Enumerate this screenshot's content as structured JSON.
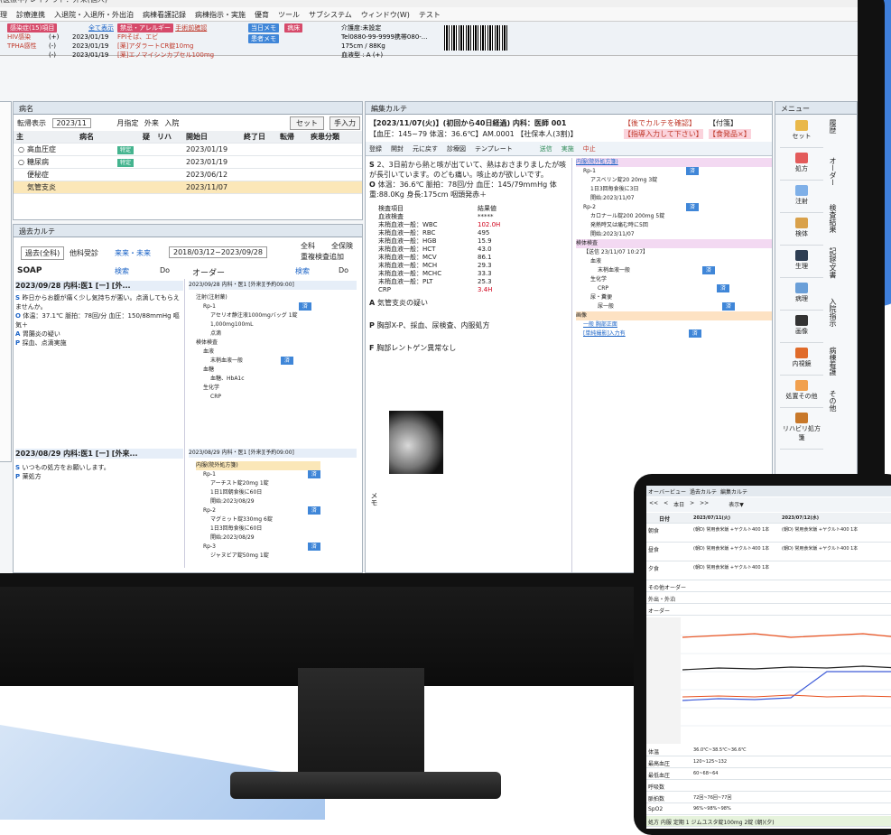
{
  "window": {
    "title": "環境(医療中) レイアウト：外来(個人)",
    "menu": [
      "者管理",
      "診療連携",
      "入退院・入退所・外出泊",
      "病棟看護記録",
      "病棟指示・実施",
      "優育",
      "ツール",
      "サブシステム",
      "ウィンドウ(W)",
      "テスト"
    ]
  },
  "patient_bar": {
    "alerts": [
      "感染症(15)項目",
      "HIV感染",
      "TPHA感性",
      "HBs抗原"
    ],
    "alert_vals": [
      "(+)",
      "(-)",
      "(-)"
    ],
    "alert_dates": [
      "2023/01/19",
      "2023/01/19",
      "2023/01/19"
    ],
    "all_label": "全て表示",
    "allergy_title": "禁忌・アレルギー",
    "allergy_sub": "手術前確認",
    "allergy_items": [
      "FPIそば、エビ",
      "[薬]アダラートCR錠10mg",
      "[薬]エノマイシンカプセル100mg"
    ],
    "memo_today": "当日メモ",
    "memo_patient": "患者メモ",
    "ward": "病床",
    "contact": [
      "介護度:未設定",
      "Tel0880-99-9999携帯080-...",
      "175cm / 88Kg",
      "血液型 : A (+)"
    ]
  },
  "disease_panel": {
    "tab": "病名",
    "toggle_label": "転帰表示",
    "month": "2023/11",
    "month_filter": "月指定",
    "radio_out": "外来",
    "radio_in": "入院",
    "set_btn": "セット",
    "input_btn": "手入力",
    "headers": [
      "主",
      "病名",
      "疑",
      "リハ",
      "開始日",
      "終了日",
      "転帰",
      "疾患分類"
    ],
    "rows": [
      {
        "mark": "○",
        "name": "高血圧症",
        "badge": "特定",
        "start": "2023/01/19"
      },
      {
        "mark": "○",
        "name": "糖尿病",
        "badge": "特定",
        "start": "2023/01/19"
      },
      {
        "mark": "",
        "name": "便秘症",
        "badge": "",
        "start": "2023/06/12"
      },
      {
        "mark": "",
        "name": "気管支炎",
        "badge": "",
        "start": "2023/11/07"
      }
    ]
  },
  "past_karte": {
    "tab": "過去カルテ",
    "filter_all": "過去(全科)",
    "filter_other": "他科受診",
    "filter_visit": "来来・未来",
    "range": "2018/03/12~2023/09/28",
    "whole_label": "全科",
    "whole_label2": "全保険",
    "check_label": "重複検査追加",
    "soap_label": "SOAP",
    "order_label": "オーダー",
    "search": "検索",
    "do_label": "Do",
    "entry1_title": "2023/09/28 内科:医1 [ー] [外...",
    "entry1_s": "昨日からお腹が痛く少し気持ちが悪い。点滴してもらえませんか。",
    "entry1_o": "体温：37.1℃ 脈拍：78回/分 血圧：150/88mmHg 嘔気＋",
    "entry1_a": "胃腸炎の疑い",
    "entry1_p": "採血、点滴実施",
    "order1_title": "2023/09/28 内科・医1 [外来][予約09:00]",
    "order1_items": [
      "注射(注射薬)",
      "Rp-1",
      "アセリオ静注液1000mgバッグ",
      "1,000mg100mL",
      "点滴",
      "検体検査",
      "血液",
      "末梢血液一般",
      "血糖",
      "血糖、HbA1c",
      "生化学",
      "CRP"
    ],
    "entry2_title": "2023/08/29 内科:医1 [ー] [外来...",
    "entry2_s": "いつもの処方をお願いします。",
    "entry2_p": "薬処方",
    "order2_title": "2023/08/29 内科・医1 [外来][予約09:00]",
    "order2_items": [
      "内服(院外処方箋)",
      "Rp-1",
      "アーチスト錠20mg",
      "1日1回朝食後に60日",
      "開始:2023/08/29",
      "Rp-2",
      "マグミット錠330mg",
      "1日3回毎食後に60日",
      "開始:2023/08/29",
      "Rp-3",
      "ジャヌビア錠50mg"
    ],
    "count_1": "1錠",
    "count_6": "6錠",
    "done": "済"
  },
  "karte": {
    "tab": "編集カルテ",
    "date_line": "【2023/11/07(火)】(初回から40日経過)  内科：医師 001",
    "vitals_line": "【血圧：145~79 体温：36.6℃】AM.0001  【社保本人(3割)】",
    "confirm": "【後でカルテを確認】",
    "attach": "【付箋】",
    "input_prompt": "【指導入力して下さい】",
    "stamp": "【食発品×】",
    "toolbar": [
      "登録",
      "開封",
      "元に戻す",
      "診療図",
      "テンプレート",
      "送信",
      "実施",
      "中止"
    ],
    "s_text": "2、3日前から熱と咳が出ていて、熱はおさまりましたが咳が長引いています。のども痛い。咳止めが欲しいです。",
    "o_text": "体温：36.6℃ 脈拍：78回/分 血圧：145/79mmHg 体重:88.0Kg 身長:175cm 咽頭発赤＋",
    "lab_head": [
      "検査項目",
      "結果値"
    ],
    "labs": [
      [
        "血液検査",
        "*****"
      ],
      [
        "末梢血液一般：WBC",
        "102.0H"
      ],
      [
        "末梢血液一般：RBC",
        "495"
      ],
      [
        "末梢血液一般：HGB",
        "15.9"
      ],
      [
        "末梢血液一般：HCT",
        "43.0"
      ],
      [
        "末梢血液一般：MCV",
        "86.1"
      ],
      [
        "末梢血液一般：MCH",
        "29.3"
      ],
      [
        "末梢血液一般：MCHC",
        "33.3"
      ],
      [
        "末梢血液一般：PLT",
        "25.3"
      ],
      [
        "CRP",
        "3.4H"
      ]
    ],
    "a_text": "気管支炎の疑い",
    "p_text": "胸部X-P、採血、尿検査、内服処方",
    "f_text": "胸部レントゲン異常なし",
    "memo": "メモ",
    "orders": [
      "内服(院外処方箋)",
      "Rp-1",
      "アスベリン錠20 20mg",
      "1日3回毎食後に3日",
      "開始:2023/11/07",
      "Rp-2",
      "カロナール錠200 200mg",
      "発熱時又は痛む時に5回",
      "開始:2023/11/07",
      "検体検査",
      "【送信 23/11/07 10:27】",
      "血液",
      "末梢血液一般",
      "生化学",
      "CRP",
      "尿・糞便",
      "尿一般",
      "画像",
      "一般 胸部正面",
      "[単純撮影]入力有"
    ],
    "qty_3": "3錠",
    "qty_5": "5錠"
  },
  "side_menu": {
    "tab": "メニュー",
    "buttons": [
      "セット",
      "処方",
      "注射",
      "検体",
      "生理",
      "病理",
      "画像",
      "内視鏡",
      "処置その他",
      "リハビリ処方箋"
    ],
    "vtabs": [
      "履歴",
      "オーダー",
      "検査結果",
      "記録/文書",
      "入院指示",
      "病棟看護",
      "その他"
    ]
  },
  "tablet": {
    "tabs": [
      "オーバービュー",
      "過去カルテ",
      "編集カルテ"
    ],
    "nav": [
      "<<",
      "<",
      "本日",
      ">",
      ">>"
    ],
    "display": "表示▼",
    "date_col": "日付",
    "dates": [
      "2023/07/11(火)",
      "2023/07/12(水)"
    ],
    "rows": [
      "朝食",
      "昼食",
      "夕食",
      "その他オーダー",
      "外出・外泊",
      "オーダー"
    ],
    "cell": "(朝D) 常用食米飯 +ヤクルト400 1本",
    "nutr": "栄養",
    "vital_rows": [
      "体温",
      "最高血圧",
      "最低血圧",
      "呼吸数",
      "脈拍数",
      "SpO2",
      "体重",
      "イベント"
    ],
    "vital_vals": [
      "36.0℃~38.5℃~36.6℃",
      "120~125~132",
      "60~68~64",
      "72回~76回~77回",
      "96%~98%~98%"
    ],
    "footer": "処方 内服 定期 1 ジムユスタ錠100mg 2錠 (朝)(夕)"
  }
}
